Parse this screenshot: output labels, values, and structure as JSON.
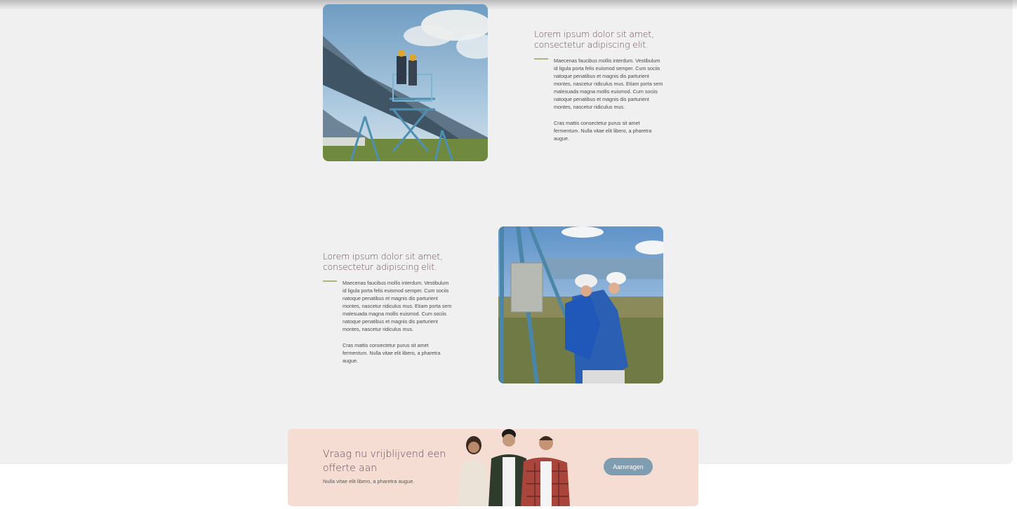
{
  "sections": [
    {
      "image_alt": "Two engineers on a scissor lift inspecting an elevated solar panel array",
      "heading": "Lorem ipsum dolor sit amet, consectetur adipiscing elit.",
      "paragraph_1": "Maecenas faucibus mollis interdum. Vestibulum id ligula porta felis euismod semper. Cum sociis natoque penatibus et magnis dis parturient montes, nascetur ridiculus mus. Etiam porta sem malesuada magna mollis euismod. Cum sociis natoque penatibus et magnis dis parturient montes, nascetur ridiculus mus.",
      "paragraph_2": "Cras mattis consectetur purus sit amet fermentum. Nulla vitae elit libero, a pharetra augue."
    },
    {
      "image_alt": "Two technicians in hard hats and blue work jackets checking an inverter box in a solar field",
      "heading": "Lorem ipsum dolor sit amet, consectetur adipiscing elit.",
      "paragraph_1": "Maecenas faucibus mollis interdum. Vestibulum id ligula porta felis euismod semper. Cum sociis natoque penatibus et magnis dis parturient montes, nascetur ridiculus mus. Etiam porta sem malesuada magna mollis euismod. Cum sociis natoque penatibus et magnis dis parturient montes, nascetur ridiculus mus.",
      "paragraph_2": "Cras mattis consectetur purus sit amet fermentum. Nulla vitae elit libero, a pharetra augue."
    }
  ],
  "cta": {
    "title": "Vraag nu vrijblijvend een offerte aan",
    "subtitle": "Nulla vitae elit libero, a pharetra augue.",
    "button_label": "Aanvragen"
  },
  "colors": {
    "heading": "#6b4b5e",
    "accent_line": "#a9b77e",
    "cta_background": "#f5ddd3",
    "button": "#7f9db1",
    "page_background": "#f0f0f0"
  }
}
